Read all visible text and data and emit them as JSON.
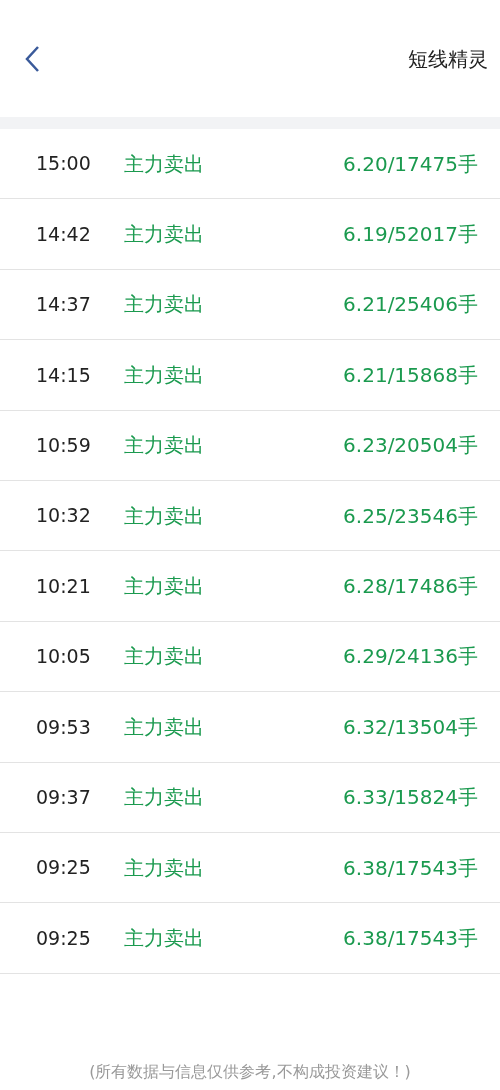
{
  "header": {
    "title": "短线精灵"
  },
  "rows": [
    {
      "time": "15:00",
      "action": "主力卖出",
      "value": "6.20/17475手"
    },
    {
      "time": "14:42",
      "action": "主力卖出",
      "value": "6.19/52017手"
    },
    {
      "time": "14:37",
      "action": "主力卖出",
      "value": "6.21/25406手"
    },
    {
      "time": "14:15",
      "action": "主力卖出",
      "value": "6.21/15868手"
    },
    {
      "time": "10:59",
      "action": "主力卖出",
      "value": "6.23/20504手"
    },
    {
      "time": "10:32",
      "action": "主力卖出",
      "value": "6.25/23546手"
    },
    {
      "time": "10:21",
      "action": "主力卖出",
      "value": "6.28/17486手"
    },
    {
      "time": "10:05",
      "action": "主力卖出",
      "value": "6.29/24136手"
    },
    {
      "time": "09:53",
      "action": "主力卖出",
      "value": "6.32/13504手"
    },
    {
      "time": "09:37",
      "action": "主力卖出",
      "value": "6.33/15824手"
    },
    {
      "time": "09:25",
      "action": "主力卖出",
      "value": "6.38/17543手"
    },
    {
      "time": "09:25",
      "action": "主力卖出",
      "value": "6.38/17543手"
    }
  ],
  "footer": "(所有数据与信息仅供参考,不构成投资建议！)"
}
